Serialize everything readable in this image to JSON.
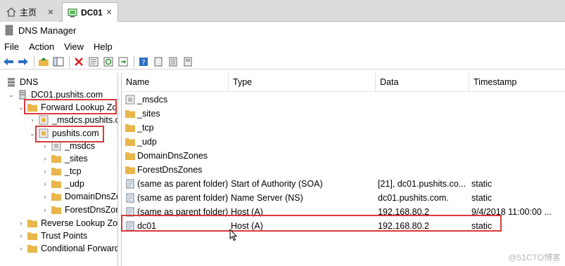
{
  "tabs": [
    {
      "label": "主页",
      "icon": "home-icon"
    },
    {
      "label": "DC01",
      "icon": "console-icon"
    }
  ],
  "window": {
    "title": "DNS Manager"
  },
  "menu": [
    "File",
    "Action",
    "View",
    "Help"
  ],
  "toolbar": [
    "back-icon",
    "forward-icon",
    "up-folder-icon",
    "show-hide-tree-icon",
    "delete-icon",
    "properties-icon",
    "refresh-icon",
    "export-list-icon",
    "help-icon",
    "record-icon",
    "record-list-icon",
    "record-detail-icon"
  ],
  "tree": {
    "root": "DNS",
    "server": "DC01.pushits.com",
    "forward": "Forward Lookup Zo",
    "msdcs_zone": "_msdcs.pushits.co",
    "zone": "pushits.com",
    "children": [
      "_msdcs",
      "_sites",
      "_tcp",
      "_udp",
      "DomainDnsZo",
      "ForestDnsZon"
    ],
    "reverse": "Reverse Lookup Zo",
    "trust": "Trust Points",
    "conditional": "Conditional Forward"
  },
  "columns": [
    "Name",
    "Type",
    "Data",
    "Timestamp"
  ],
  "records": [
    {
      "name": "_msdcs",
      "type": "",
      "data": "",
      "timestamp": "",
      "icon": "delegated-folder-icon"
    },
    {
      "name": "_sites",
      "type": "",
      "data": "",
      "timestamp": "",
      "icon": "folder-icon"
    },
    {
      "name": "_tcp",
      "type": "",
      "data": "",
      "timestamp": "",
      "icon": "folder-icon"
    },
    {
      "name": "_udp",
      "type": "",
      "data": "",
      "timestamp": "",
      "icon": "folder-icon"
    },
    {
      "name": "DomainDnsZones",
      "type": "",
      "data": "",
      "timestamp": "",
      "icon": "folder-icon"
    },
    {
      "name": "ForestDnsZones",
      "type": "",
      "data": "",
      "timestamp": "",
      "icon": "folder-icon"
    },
    {
      "name": "(same as parent folder)",
      "type": "Start of Authority (SOA)",
      "data": "[21], dc01.pushits.co...",
      "timestamp": "static",
      "icon": "record-icon"
    },
    {
      "name": "(same as parent folder)",
      "type": "Name Server (NS)",
      "data": "dc01.pushits.com.",
      "timestamp": "static",
      "icon": "record-icon"
    },
    {
      "name": "(same as parent folder)",
      "type": "Host (A)",
      "data": "192.168.80.2",
      "timestamp": "9/4/2018 11:00:00 ...",
      "icon": "record-icon"
    },
    {
      "name": "dc01",
      "type": "Host (A)",
      "data": "192.168.80.2",
      "timestamp": "static",
      "icon": "record-icon"
    }
  ],
  "watermark": "@51CTO博客",
  "colors": {
    "highlight": "#d9393b",
    "folder": "#e8b64a"
  }
}
